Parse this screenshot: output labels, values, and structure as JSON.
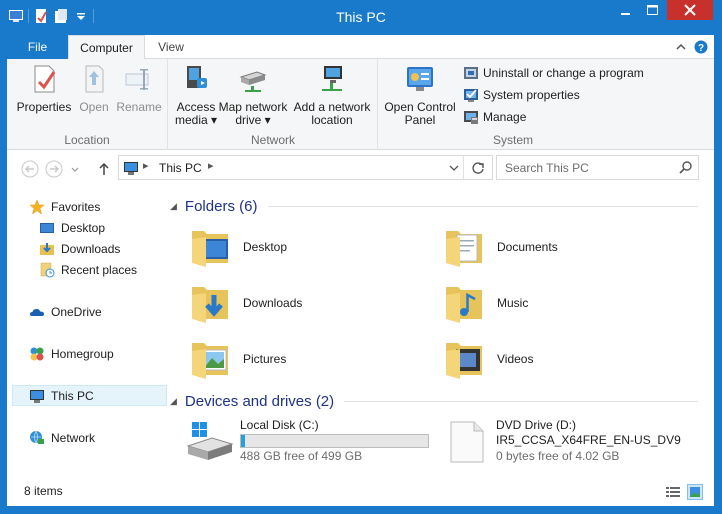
{
  "window": {
    "title": "This PC"
  },
  "tabs": {
    "file": "File",
    "computer": "Computer",
    "view": "View"
  },
  "ribbon": {
    "location": {
      "label": "Location",
      "properties": "Properties",
      "open": "Open",
      "rename": "Rename"
    },
    "network": {
      "label": "Network",
      "access_media": [
        "Access",
        "media ▾"
      ],
      "map_drive": [
        "Map network",
        "drive ▾"
      ],
      "add_location": [
        "Add a network",
        "location"
      ]
    },
    "system": {
      "label": "System",
      "control_panel": [
        "Open Control",
        "Panel"
      ],
      "uninstall": "Uninstall or change a program",
      "system_properties": "System properties",
      "manage": "Manage"
    }
  },
  "address": {
    "path": "This PC",
    "search_placeholder": "Search This PC"
  },
  "navpane": {
    "favorites": "Favorites",
    "desktop": "Desktop",
    "downloads": "Downloads",
    "recent": "Recent places",
    "onedrive": "OneDrive",
    "homegroup": "Homegroup",
    "thispc": "This PC",
    "network": "Network"
  },
  "folders": {
    "header": "Folders (6)",
    "items": [
      "Desktop",
      "Documents",
      "Downloads",
      "Music",
      "Pictures",
      "Videos"
    ]
  },
  "devices": {
    "header": "Devices and drives (2)",
    "local": {
      "name": "Local Disk (C:)",
      "free": "488 GB free of 499 GB",
      "used_fraction": 0.022
    },
    "dvd": {
      "name": "DVD Drive (D:)",
      "label": "IR5_CCSA_X64FRE_EN-US_DV9",
      "free": "0 bytes free of 4.02 GB"
    }
  },
  "status": {
    "items": "8 items"
  },
  "colors": {
    "accent": "#1979ca",
    "close": "#c7302b",
    "header_text": "#1e3287",
    "drive_bar": "#26a0da"
  }
}
